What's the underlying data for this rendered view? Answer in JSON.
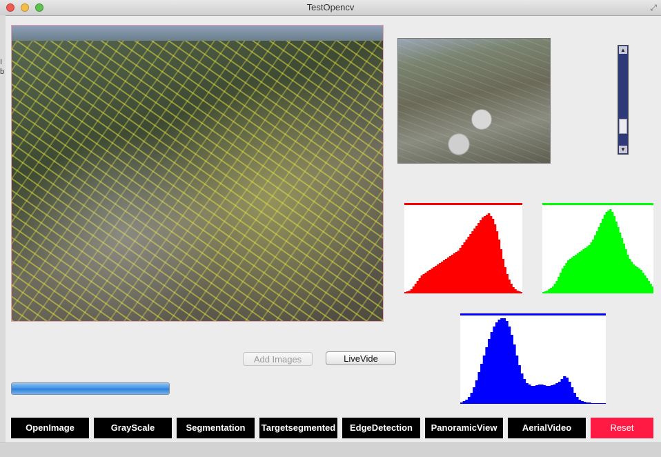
{
  "window": {
    "title": "TestOpencv"
  },
  "edge_chars": [
    "I",
    "b"
  ],
  "buttons": {
    "add_images": "Add Images",
    "live_video": "LiveVide"
  },
  "progress": {
    "value_percent": 100
  },
  "toolbar": [
    {
      "label": "OpenImage",
      "name": "open-image-button"
    },
    {
      "label": "GrayScale",
      "name": "grayscale-button"
    },
    {
      "label": "Segmentation",
      "name": "segmentation-button"
    },
    {
      "label": "Targetsegmented",
      "name": "target-segmented-button"
    },
    {
      "label": "EdgeDetection",
      "name": "edge-detection-button"
    },
    {
      "label": "PanoramicView",
      "name": "panoramic-view-button"
    },
    {
      "label": "AerialVideo",
      "name": "aerial-video-button"
    },
    {
      "label": "Reset",
      "name": "reset-button"
    }
  ],
  "colors": {
    "red": "#ff0000",
    "green": "#00ff00",
    "blue": "#0000ff",
    "reset": "#ff1a44"
  },
  "histograms": {
    "red": [
      2,
      3,
      4,
      6,
      10,
      14,
      18,
      22,
      26,
      28,
      30,
      32,
      34,
      36,
      38,
      40,
      42,
      44,
      46,
      48,
      50,
      52,
      54,
      56,
      58,
      60,
      62,
      66,
      70,
      74,
      78,
      82,
      86,
      90,
      94,
      98,
      102,
      106,
      110,
      112,
      114,
      116,
      112,
      108,
      100,
      90,
      78,
      64,
      50,
      38,
      28,
      20,
      14,
      9,
      6,
      4,
      3,
      2
    ],
    "green": [
      2,
      3,
      4,
      6,
      8,
      10,
      14,
      18,
      24,
      30,
      36,
      40,
      44,
      48,
      50,
      52,
      54,
      56,
      58,
      60,
      62,
      64,
      66,
      68,
      70,
      74,
      78,
      84,
      90,
      96,
      102,
      108,
      114,
      118,
      120,
      122,
      118,
      112,
      104,
      96,
      88,
      80,
      72,
      64,
      56,
      50,
      46,
      42,
      40,
      38,
      36,
      34,
      30,
      26,
      22,
      18,
      14,
      10
    ],
    "blue": [
      2,
      4,
      6,
      10,
      16,
      24,
      34,
      46,
      58,
      70,
      82,
      94,
      104,
      112,
      118,
      122,
      124,
      124,
      120,
      112,
      100,
      86,
      70,
      56,
      44,
      36,
      30,
      28,
      26,
      26,
      27,
      28,
      28,
      27,
      26,
      26,
      27,
      28,
      30,
      32,
      36,
      40,
      38,
      32,
      24,
      16,
      10,
      6,
      4,
      3,
      2,
      2,
      1,
      1,
      1,
      1,
      1,
      1
    ]
  }
}
